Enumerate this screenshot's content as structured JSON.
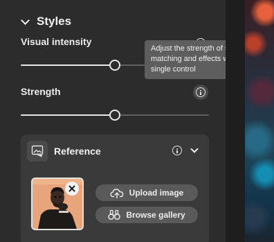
{
  "panel": {
    "section": {
      "title": "Styles"
    },
    "visual_intensity": {
      "label": "Visual intensity",
      "value_fraction": 0.5
    },
    "strength": {
      "label": "Strength",
      "value_fraction": 0.5
    },
    "tooltip": {
      "text": "Adjust the strength of style matching and effects with a single control"
    },
    "reference": {
      "title": "Reference",
      "upload_label": "Upload image",
      "browse_label": "Browse gallery"
    }
  },
  "icons": {
    "section_toggle": "chevron-down-icon",
    "info": "info-icon",
    "reference": "image-reference-icon",
    "expand": "chevron-down-icon",
    "remove": "close-icon",
    "upload": "cloud-upload-icon",
    "browse": "binoculars-icon"
  },
  "colors": {
    "panel_bg": "#2c2c2c",
    "card_bg": "#3a3a3a",
    "tooltip_bg": "#5e5e5e",
    "button_bg": "#5a5a5a",
    "slider_fill": "#e8e8e8",
    "slider_track": "#5f5f5f"
  }
}
